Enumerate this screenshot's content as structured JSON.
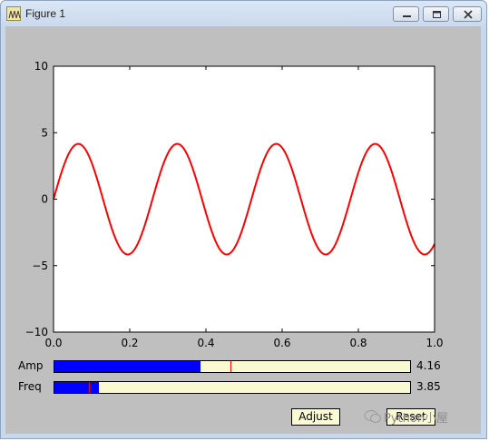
{
  "window": {
    "title": "Figure 1",
    "controls": {
      "minimize": "minimize-icon",
      "maximize": "maximize-icon",
      "close": "close-icon"
    }
  },
  "chart_data": {
    "type": "line",
    "title": "",
    "xlabel": "",
    "ylabel": "",
    "xlim": [
      0.0,
      1.0
    ],
    "ylim": [
      -10,
      10
    ],
    "x_ticks": [
      "0.0",
      "0.2",
      "0.4",
      "0.6",
      "0.8",
      "1.0"
    ],
    "y_ticks": [
      "10",
      "5",
      "0",
      "−5",
      "−10"
    ],
    "grid": false,
    "series": [
      {
        "color": "#ff0000",
        "function": "A*sin(2*pi*f*t)",
        "amplitude": 4.16,
        "frequency": 3.85,
        "x_range": [
          0.0,
          1.0
        ]
      }
    ]
  },
  "sliders": [
    {
      "label": "Amp",
      "value_text": "4.16",
      "min": 0.1,
      "max": 10.0,
      "value": 4.16,
      "init": 5.0,
      "fill_color": "#0000ff",
      "track_color": "#fafad2",
      "handle_color": "#ff0000"
    },
    {
      "label": "Freq",
      "value_text": "3.85",
      "min": 0.1,
      "max": 30.0,
      "value": 3.85,
      "init": 3.0,
      "fill_color": "#0000ff",
      "track_color": "#fafad2",
      "handle_color": "#ff0000"
    }
  ],
  "buttons": {
    "adjust": "Adjust",
    "reset": "Reset"
  },
  "watermark": {
    "text": "Python小屋"
  }
}
